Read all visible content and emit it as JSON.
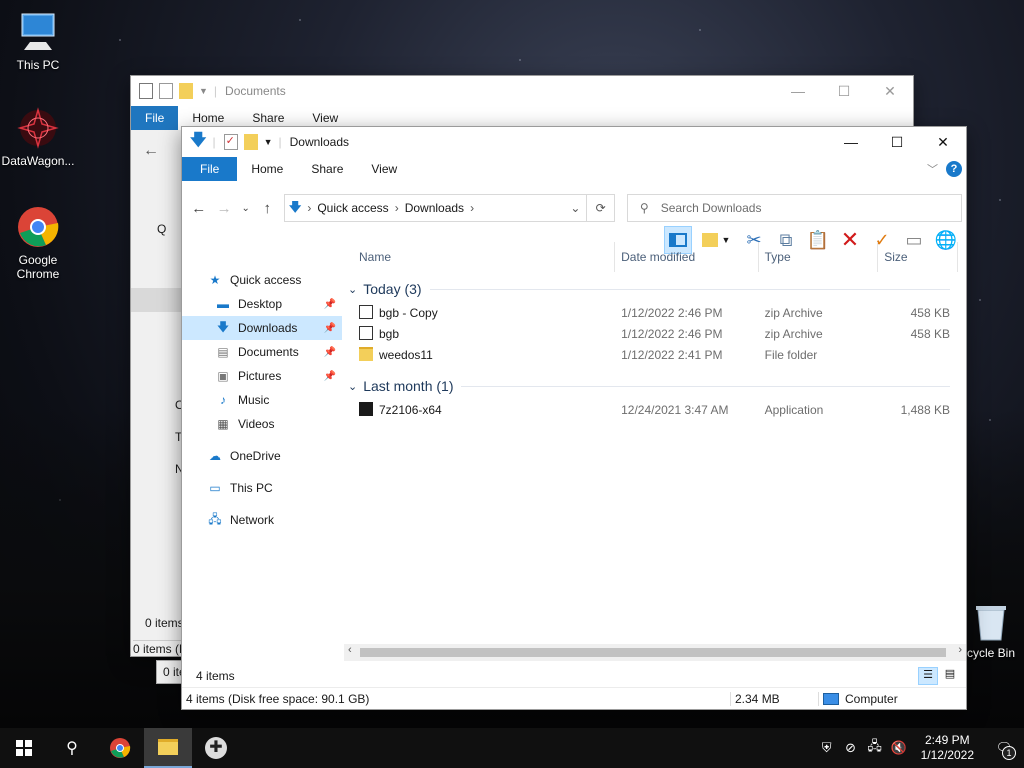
{
  "desktop": {
    "icons": [
      {
        "label": "This PC"
      },
      {
        "label": "DataWagon..."
      },
      {
        "label": "Google Chrome"
      },
      {
        "label": "cycle Bin"
      }
    ]
  },
  "back_window": {
    "title": "Documents",
    "tabs": [
      "File",
      "Home",
      "Share",
      "View"
    ],
    "status_a": "0 items",
    "status_b": "0 items (D",
    "status_c": "0 ite",
    "nav_fragments": [
      "Q",
      "O",
      "T",
      "N"
    ]
  },
  "window": {
    "title": "Downloads",
    "tabs": [
      "File",
      "Home",
      "Share",
      "View"
    ],
    "breadcrumb": [
      "Quick access",
      "Downloads"
    ],
    "search_placeholder": "Search Downloads",
    "nav": [
      {
        "label": "Quick access",
        "icon": "star"
      },
      {
        "label": "Desktop",
        "icon": "desktop",
        "pinned": true
      },
      {
        "label": "Downloads",
        "icon": "download",
        "pinned": true
      },
      {
        "label": "Documents",
        "icon": "document",
        "pinned": true
      },
      {
        "label": "Pictures",
        "icon": "pictures",
        "pinned": true
      },
      {
        "label": "Music",
        "icon": "music"
      },
      {
        "label": "Videos",
        "icon": "videos"
      },
      {
        "label": "OneDrive",
        "icon": "cloud"
      },
      {
        "label": "This PC",
        "icon": "pc"
      },
      {
        "label": "Network",
        "icon": "network"
      }
    ],
    "columns": [
      "Name",
      "Date modified",
      "Type",
      "Size"
    ],
    "groups": [
      {
        "label": "Today (3)",
        "files": [
          {
            "name": "bgb - Copy",
            "date": "1/12/2022 2:46 PM",
            "type": "zip Archive",
            "size": "458 KB"
          },
          {
            "name": "bgb",
            "date": "1/12/2022 2:46 PM",
            "type": "zip Archive",
            "size": "458 KB"
          },
          {
            "name": "weedos11",
            "date": "1/12/2022 2:41 PM",
            "type": "File folder",
            "size": ""
          }
        ]
      },
      {
        "label": "Last month (1)",
        "files": [
          {
            "name": "7z2106-x64",
            "date": "12/24/2021 3:47 AM",
            "type": "Application",
            "size": "1,488 KB"
          }
        ]
      }
    ],
    "item_count": "4 items",
    "status_left": "4 items (Disk free space: 90.1 GB)",
    "status_size": "2.34 MB",
    "status_location": "Computer"
  },
  "taskbar": {
    "time": "2:49 PM",
    "date": "1/12/2022",
    "notification_count": "1"
  },
  "colors": {
    "accent": "#1979ca",
    "selection": "#cce8ff"
  }
}
